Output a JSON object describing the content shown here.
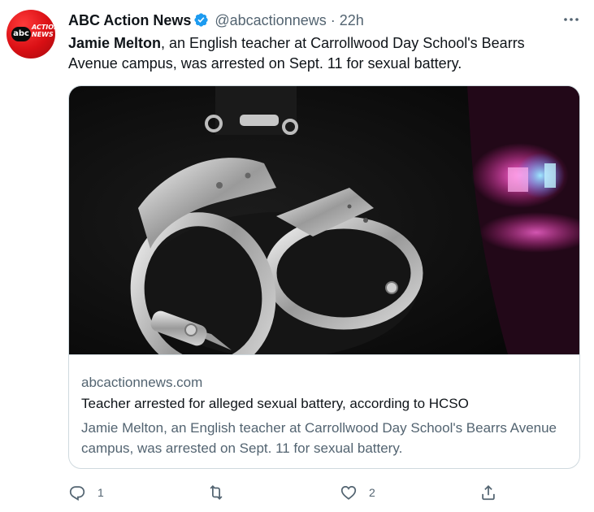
{
  "tweet": {
    "author_name": "ABC Action News",
    "handle": "@abcactionnews",
    "separator": "·",
    "time": "22h",
    "avatar": {
      "logo_text": "abc",
      "sub_text": "ACTION NEWS",
      "color": "#d90f14"
    },
    "text_bold": "Jamie Melton",
    "text_rest": ", an English teacher at Carrollwood Day School's Bearrs Avenue campus, was arrested on Sept. 11 for sexual battery."
  },
  "card": {
    "image_icon": "handcuffs-photo",
    "domain": "abcactionnews.com",
    "title": "Teacher arrested for alleged sexual battery, according to HCSO",
    "description": "Jamie Melton, an English teacher at Carrollwood Day School's Bearrs Avenue campus, was arrested on Sept. 11 for sexual battery."
  },
  "actions": {
    "reply": {
      "icon": "reply-icon",
      "count": "1"
    },
    "retweet": {
      "icon": "retweet-icon",
      "count": ""
    },
    "like": {
      "icon": "heart-icon",
      "count": "2"
    },
    "share": {
      "icon": "share-icon",
      "count": ""
    }
  },
  "colors": {
    "secondary_text": "#536471",
    "verified": "#1d9bf0",
    "border": "#cfd9de"
  }
}
